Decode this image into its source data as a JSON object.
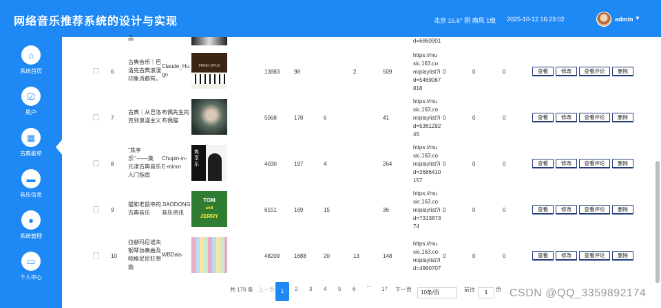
{
  "app": {
    "title": "网络音乐推荐系统的设计与实现"
  },
  "header": {
    "weather": "北京 16.6° 阴 南风 1级",
    "datetime": "2025-10-12 16:23:02",
    "user": "admin",
    "caret": "▼"
  },
  "sidebar": {
    "items": [
      {
        "label": "系统首页",
        "icon": "home-icon",
        "glyph": "⌂"
      },
      {
        "label": "用户",
        "icon": "clipboard-user-icon",
        "glyph": "☑"
      },
      {
        "label": "古典歌单",
        "icon": "grid-icon",
        "glyph": "▦"
      },
      {
        "label": "音乐信息",
        "icon": "briefcase-icon",
        "glyph": "▬"
      },
      {
        "label": "系统管理",
        "icon": "lightbulb-icon",
        "glyph": "●"
      },
      {
        "label": "个人中心",
        "icon": "wallet-icon",
        "glyph": "▭"
      }
    ]
  },
  "partial_row": {
    "name_tail": "品",
    "url_tail": "d=6860901"
  },
  "rows": [
    {
      "index": "6",
      "name_lines": [
        "古典音乐｜巴",
        "洛克古典浪漫",
        "印象派都有。"
      ],
      "author_lines": [
        "Claude_Hu",
        "go"
      ],
      "c1": "13883",
      "c2": "98",
      "c3": "",
      "c4": "2",
      "c5": "509",
      "url_lines": [
        "https://mu",
        "sic.163.co",
        "m/playlist?i",
        "d=5469067",
        "818"
      ],
      "c6": "0",
      "c7": "0",
      "c8": "0",
      "thumb": "piano"
    },
    {
      "index": "7",
      "name_lines": [
        "古典｜从巴洛",
        "克到浪漫主义"
      ],
      "author_lines": [
        "布偶先生的",
        "布偶猫"
      ],
      "c1": "5068",
      "c2": "178",
      "c3": "6",
      "c4": "",
      "c5": "41",
      "url_lines": [
        "https://mu",
        "sic.163.co",
        "m/playlist?i",
        "d=5361292",
        "45"
      ],
      "c6": "0",
      "c7": "0",
      "c8": "0",
      "thumb": "painting"
    },
    {
      "index": "8",
      "name_lines": [
        "\"焦享",
        "乐\" ——集",
        "元津古典音乐",
        "入门指南"
      ],
      "author_lines": [
        "Chopin-in-",
        "E-minor"
      ],
      "c1": "4030",
      "c2": "197",
      "c3": "4",
      "c4": "",
      "c5": "264",
      "url_lines": [
        "https://mu",
        "sic.163.co",
        "m/playlist?i",
        "d=2686410",
        "157"
      ],
      "c6": "0",
      "c7": "0",
      "c8": "0",
      "thumb": "portrait"
    },
    {
      "index": "9",
      "name_lines": [
        "猫和老鼠中的",
        "古典音乐"
      ],
      "author_lines": [
        "JIAODONG",
        "音乐资讯"
      ],
      "c1": "6151",
      "c2": "169",
      "c3": "15",
      "c4": "",
      "c5": "36",
      "url_lines": [
        "https://mu",
        "sic.163.co",
        "m/playlist?i",
        "d=7313873",
        "74"
      ],
      "c6": "0",
      "c7": "0",
      "c8": "0",
      "thumb": "tomjerry"
    },
    {
      "index": "10",
      "name_lines": [
        "拉赫玛尼诺夫",
        "钢琴协奏曲及",
        "帕格尼尼狂想",
        "曲"
      ],
      "author_lines": [
        "WBDais"
      ],
      "c1": "48209",
      "c2": "1688",
      "c3": "20",
      "c4": "13",
      "c5": "148",
      "url_lines": [
        "https://mu",
        "sic.163.co",
        "m/playlist?i",
        "d=4960707"
      ],
      "c6": "0",
      "c7": "0",
      "c8": "0",
      "thumb": "mosaic"
    }
  ],
  "thumb_texts": {
    "piano": "PIANO OPUS",
    "portrait": "焦享乐",
    "tom": "TOM",
    "and": "and",
    "jerry": "JERRY"
  },
  "actions": {
    "view": "查看",
    "edit": "修改",
    "comments": "查看评论",
    "delete": "删除"
  },
  "pagination": {
    "total": "共 170 条",
    "prev": "上一页",
    "pages": [
      "1",
      "2",
      "3",
      "4",
      "5",
      "6"
    ],
    "ellipsis": "···",
    "last": "17",
    "next": "下一页",
    "page_size": "10条/页",
    "goto_label": "前往",
    "goto_value": "1",
    "goto_suffix": "页"
  },
  "watermark": "CSDN @QQ_3359892174"
}
